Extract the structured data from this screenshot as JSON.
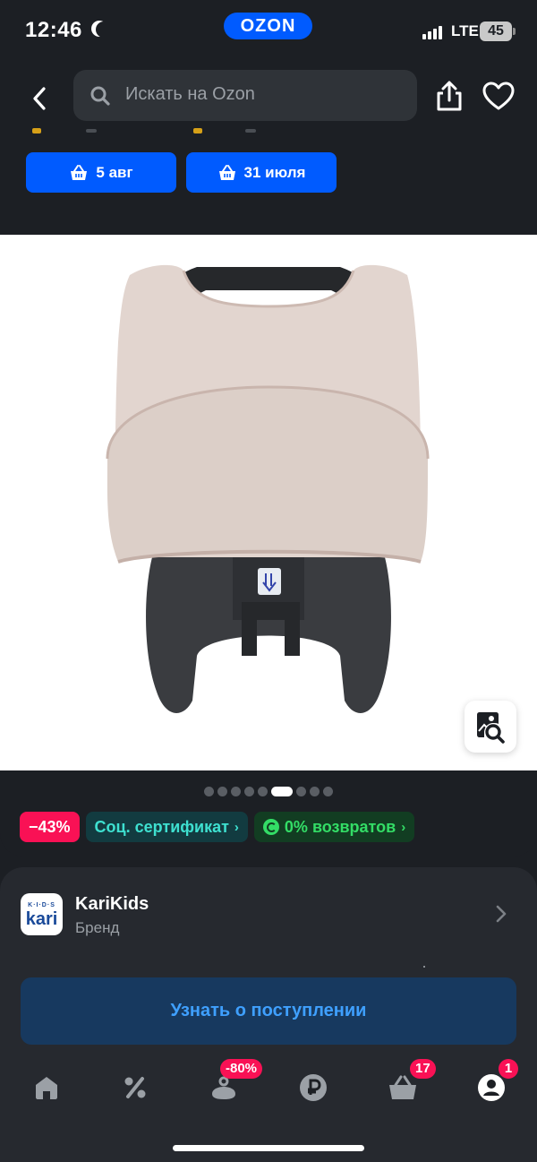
{
  "status_bar": {
    "time": "12:46",
    "network": "LTE",
    "battery": "45"
  },
  "brand_logo": "OZON",
  "header": {
    "search_placeholder": "Искать на Ozon",
    "delivery_buttons": [
      {
        "label": "5 авг"
      },
      {
        "label": "31 июля"
      }
    ]
  },
  "gallery": {
    "total_images": 9,
    "active_index": 5
  },
  "chips": {
    "discount": "−43%",
    "certificate": "Соц. сертификат",
    "returns": "0% возвратов"
  },
  "brand": {
    "name": "KariKids",
    "subtitle": "Бренд",
    "logo_text": "kari",
    "logo_small": "K·I·D·S"
  },
  "notify_button": "Узнать о поступлении",
  "bottom_nav": {
    "items": [
      {
        "name": "home",
        "badge": ""
      },
      {
        "name": "discounts",
        "badge": ""
      },
      {
        "name": "fresh",
        "badge": "-80%"
      },
      {
        "name": "finance",
        "badge": ""
      },
      {
        "name": "cart",
        "badge": "17"
      },
      {
        "name": "profile",
        "badge": "1"
      }
    ]
  },
  "colors": {
    "accent": "#005bff",
    "discount": "#f91155",
    "background": "#1c1f24",
    "card": "#26292f"
  }
}
